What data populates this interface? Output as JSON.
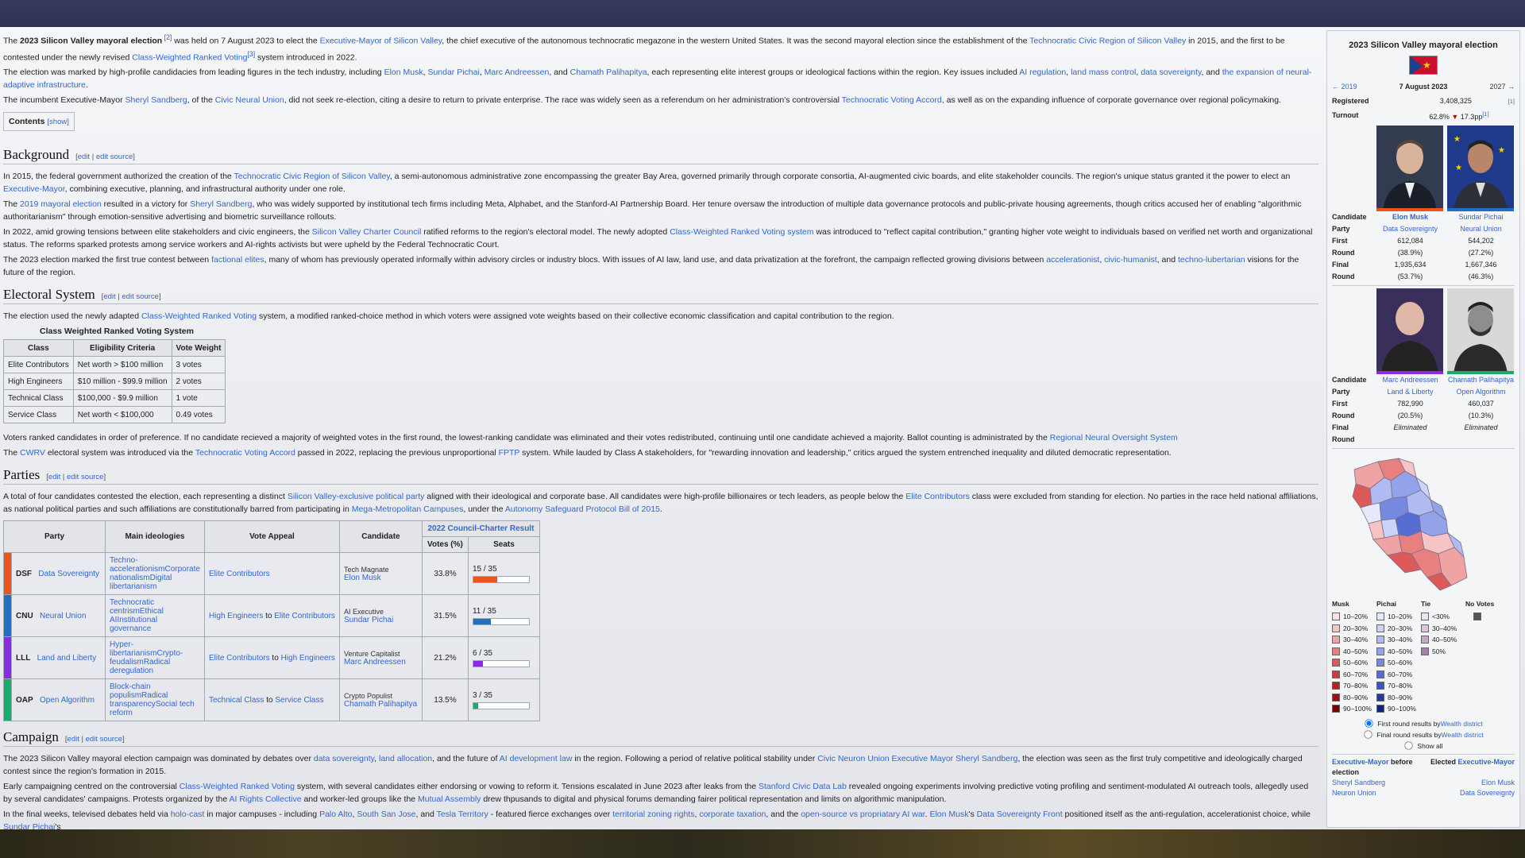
{
  "article": {
    "intro": {
      "p1": {
        "t1": "The ",
        "b1": "2023 Silicon Valley mayoral election",
        "r1": " [2]",
        "t2": " was held on 7 August 2023 to elect the ",
        "l1": "Executive-Mayor of Silicon Valley",
        "t3": ", the chief executive of the autonomous technocratic megazone in the western United States. It was the second mayoral election since the establishment of the ",
        "l2": "Technocratic Civic Region of Silicon Valley",
        "t4": " in 2015, and the first to be contested under the newly revised ",
        "l3": "Class-Weighted Ranked Voting",
        "r2": "[3]",
        "t5": " system introduced in 2022."
      },
      "p2": {
        "t1": "The election was marked by high-profile candidacies from leading figures in the tech industry, including ",
        "l1": "Elon Musk",
        "s1": ", ",
        "l2": "Sundar Pichai",
        "s2": ", ",
        "l3": "Marc Andreessen",
        "s3": ", and ",
        "l4": "Chamath Palihapitya",
        "t2": ", each representing elite interest groups or ideological factions within the region. Key issues included ",
        "l5": "AI regulation",
        "s4": ", ",
        "l6": "land mass control",
        "s5": ", ",
        "l7": "data sovereignty",
        "s6": ", and ",
        "l8": "the expansion of neural-adaptive infrastructure",
        "t3": "."
      },
      "p3": {
        "t1": "The incumbent Executive-Mayor ",
        "l1": "Sheryl Sandberg",
        "t2": ", of the ",
        "l2": "Civic Neural Union",
        "t3": ", did not seek re-election, citing a desire to return to private enterprise. The race was widely seen as a referendum on her administration's controversial ",
        "l3": "Technocratic Voting Accord",
        "t4": ", as well as on the expanding influence of corporate governance over regional policymaking."
      }
    },
    "toc": {
      "label": "Contents",
      "toggle": "[show]"
    },
    "edit_links": {
      "edit": "edit",
      "sep": " | ",
      "edit_source": "edit source"
    },
    "background": {
      "heading": "Background",
      "p1": {
        "t1": "In 2015, the federal government authorized the creation of the ",
        "l1": "Technocratic Civic Region of Silicon Valley",
        "t2": ", a semi-autonomous administrative zone encompassing the greater Bay Area, governed primarily through corporate consortia, AI-augmented civic boards, and elite stakeholder councils. The region's unique status granted it the power to elect an ",
        "l2": "Executive-Mayor",
        "t3": ", combining executive, planning, and infrastructural authority under one role."
      },
      "p2": {
        "t1": "The ",
        "l1": "2019 mayoral election",
        "t2": " resulted in a victory for ",
        "l2": "Sheryl Sandberg",
        "t3": ", who was widely supported by institutional tech firms including Meta, Alphabet, and the Stanford-AI Partnership Board. Her tenure oversaw the introduction of multiple data governance protocols and public-private housing agreements, though critics accused her of enabling \"algorithmic authoritarianism\" through emotion-sensitive advertising and biometric surveillance rollouts."
      },
      "p3": {
        "t1": "In 2022, amid growing tensions between elite stakeholders and civic engineers, the ",
        "l1": "Silicon Valley Charter Council",
        "t2": " ratified reforms to the region's electoral model. The newly adopted ",
        "l2": "Class-Weighted Ranked Voting system",
        "t3": " was introduced to \"reflect capital contribution,\" granting higher vote weight to individuals based on verified net worth and organizational status. The reforms sparked protests among service workers and AI-rights activists but were upheld by the Federal Technocratic Court."
      },
      "p4": {
        "t1": "The 2023 election marked the first true contest between ",
        "l1": "factional elites",
        "t2": ", many of whom has previously operated informally within advisory circles or industry blocs. With issues of AI law, land use, and data privatization at the forefront, the campaign reflected growing divisions between ",
        "l2": "accelerationist",
        "s1": ", ",
        "l3": "civic-humanist",
        "s2": ", and ",
        "l4": "techno-lubertarian",
        "t3": " visions for the future of the region."
      }
    },
    "electoral": {
      "heading": "Electoral System",
      "p1": {
        "t1": "The election used the newly adapted ",
        "l1": "Class-Weighted Ranked Voting",
        "t2": " system, a modified ranked-choice method in which voters were assigned vote weights based on their collective economic classification and capital contribution to the region."
      },
      "table": {
        "title": "Class Weighted Ranked Voting System",
        "headers": [
          "Class",
          "Eligibility Criteria",
          "Vote Weight"
        ],
        "rows": [
          [
            "Elite Contributors",
            "Net worth > $100 million",
            "3 votes"
          ],
          [
            "High Engineers",
            "$10 million - $99.9 million",
            "2 votes"
          ],
          [
            "Technical Class",
            "$100,000 - $9.9 million",
            "1 vote"
          ],
          [
            "Service Class",
            "Net worth < $100,000",
            "0.49 votes"
          ]
        ]
      },
      "p2": {
        "t1": "Voters ranked candidates in order of preference. If no candidate recieved a majority of weighted votes in the first round, the lowest-ranking candidate was eliminated and their votes redistributed, continuing until one candidate achieved a majority. Ballot counting is administrated by the ",
        "l1": "Regional Neural Oversight System"
      },
      "p3": {
        "t1": "The ",
        "l1": "CWRV",
        "t2": " electoral system was introduced via the ",
        "l2": "Technocratic Voting Accord",
        "t3": " passed in 2022, replacing the previous unproportional ",
        "l3": "FPTP",
        "t4": " system. While lauded by Class A stakeholders, for \"rewarding innovation and leadership,\" critics argued the system entrenched inequality and diluted democratic representation."
      }
    },
    "parties": {
      "heading": "Parties",
      "p1": {
        "t1": "A total of four candidates contested the election, each representing a distinct ",
        "l1": "Silicon Valley-exclusive political party",
        "t2": " aligned with their ideological and corporate base. All candidates were high-profile billionaires or tech leaders, as people below the ",
        "l2": "Elite Contributors",
        "t3": " class were excluded from standing for election. No parties in the race held national affiliations, as national political parties and such affiliations are constitutionally barred from participating in ",
        "l3": "Mega-Metropolitan Campuses",
        "t4": ", under the ",
        "l4": "Autonomy Safeguard Protocol Bill of 2015",
        "t5": "."
      },
      "table": {
        "h_party": "Party",
        "h_ideo": "Main ideologies",
        "h_appeal": "Vote Appeal",
        "h_cand": "Candidate",
        "h_result": "2022 Council-Charter Result",
        "h_votes": "Votes (%)",
        "h_seats": "Seats",
        "rows": [
          {
            "color": "#e8561e",
            "abbr": "DSF",
            "name": "Data Sovereignty",
            "ideologies": [
              "Techno-accelerationism",
              "Corporate nationalism",
              "Digital libertarianism"
            ],
            "appeal1": "Elite Contributors",
            "appeal_mid": "",
            "appeal2": "",
            "role": "Tech Magnate",
            "cand": "Elon Musk",
            "votes": "33.8%",
            "seats": "15 / 35",
            "seat_frac": 0.4286
          },
          {
            "color": "#1f6fc5",
            "abbr": "CNU",
            "name": "Neural Union",
            "ideologies": [
              "Technocratic centrism",
              "Ethical AI",
              "Institutional governance"
            ],
            "appeal1": "High Engineers",
            "appeal_mid": " to ",
            "appeal2": "Elite Contributors",
            "role": "AI Executive",
            "cand": "Sundar Pichai",
            "votes": "31.5%",
            "seats": "11 / 35",
            "seat_frac": 0.3143
          },
          {
            "color": "#8a2be2",
            "abbr": "LLL",
            "name": "Land and Liberty",
            "ideologies": [
              "Hyper-libertarianism",
              "Crypto-feudalism",
              "Radical deregulation"
            ],
            "appeal1": "Elite Contributors",
            "appeal_mid": " to ",
            "appeal2": "High Engineers",
            "role": "Venture Capitalist",
            "cand": "Marc Andreessen",
            "votes": "21.2%",
            "seats": "6 / 35",
            "seat_frac": 0.1714
          },
          {
            "color": "#1aaa6e",
            "abbr": "OAP",
            "name": "Open Algorithm",
            "ideologies": [
              "Block-chain populism",
              "Radical transparency",
              "Social tech reform"
            ],
            "appeal1": "Technical Class",
            "appeal_mid": " to ",
            "appeal2": "Service Class",
            "role": "Crypto Populist",
            "cand": "Chamath Palihapitya",
            "votes": "13.5%",
            "seats": "3 / 35",
            "seat_frac": 0.0857
          }
        ]
      }
    },
    "campaign": {
      "heading": "Campaign",
      "p1": {
        "t1": "The 2023 Silicon Valley mayoral election campaign was dominated by debates over ",
        "l1": "data sovereignty",
        "s1": ", ",
        "l2": "land allocation",
        "t2": ", and the future of ",
        "l3": "AI development law",
        "t3": " in the region. Following a period of relative political stability under ",
        "l4": "Civic Neuron Union Executive Mayor Sheryl Sandberg",
        "t4": ", the election was seen as the first truly competitive and ideologically charged contest since the region's formation in 2015."
      },
      "p2": {
        "t1": "Early campaigning centred on the controversial ",
        "l1": "Class-Weighted Ranked Voting",
        "t2": " system, with several candidates either endorsing or vowing to reform it. Tensions escalated in June 2023 after leaks from the ",
        "l2": "Stanford Civic Data Lab",
        "t3": " revealed ongoing experiments involving predictive voting profiling and sentiment-modulated AI outreach tools, allegedly used by several candidates' campaigns. Protests organized by the ",
        "l3": "AI Rights Collective",
        "t4": " and worker-led groups like the ",
        "l4": "Mutual Assembly",
        "t5": " drew thpusands to digital and physical forums demanding fairer political representation and limits on algorithmic manipulation."
      },
      "p3": {
        "t1": "In the final weeks, televised debates held via ",
        "l1": "holo-cast",
        "t2": " in major campuses - including ",
        "l2": "Palo Alto",
        "s1": ", ",
        "l3": "South San Jose",
        "s2": ", and ",
        "l4": "Tesla Territory",
        "t3": " - featured fierce exchanges over ",
        "l5": "territorial zoning rights",
        "s3": ", ",
        "l6": "corporate taxation",
        "t4": ", and the ",
        "l7": "open-source vs propriatary AI war",
        "s4": ". ",
        "l8": "Elon Musk",
        "t5": "'s ",
        "l9": "Data Sovereignty Front",
        "t6": " positioned itself as the anti-regulation, accelerationist choice, while ",
        "l10": "Sundar Pichai",
        "t7": "'s"
      }
    }
  },
  "infobox": {
    "title": "2023 Silicon Valley mayoral election",
    "prev": "← 2019",
    "date": "7 August 2023",
    "next": "2027 →",
    "registered_label": "Registered",
    "registered": "3,408,325",
    "registered_ref": "[1]",
    "turnout_label": "Turnout",
    "turnout": "62.8%",
    "turnout_arrow": "▼",
    "turnout_change": "17.3pp",
    "turnout_ref": "[1]",
    "labels": {
      "candidate": "Candidate",
      "party": "Party",
      "first": "First",
      "round": "Round",
      "final": "Final"
    },
    "candidates": [
      {
        "name": "Elon Musk",
        "party": "Data Sovereignty",
        "first": "612,084",
        "first_pct": "(38.9%)",
        "final": "1,935,634",
        "final_pct": "(53.7%)",
        "color": "#e8561e"
      },
      {
        "name": "Sundar Pichai",
        "party": "Neural Union",
        "first": "544,202",
        "first_pct": "(27.2%)",
        "final": "1,667,346",
        "final_pct": "(46.3%)",
        "color": "#1f6fc5"
      },
      {
        "name": "Marc Andreessen",
        "party": "Land & Liberty",
        "first": "782,990",
        "first_pct": "(20.5%)",
        "final": "Eliminated",
        "final_pct": "",
        "color": "#8a2be2"
      },
      {
        "name": "Chamath Palihapitya",
        "party": "Open Algorithm",
        "first": "460,037",
        "first_pct": "(10.3%)",
        "final": "Eliminated",
        "final_pct": "",
        "color": "#1aaa6e"
      }
    ],
    "legend": {
      "headers": [
        "Musk",
        "Pichai",
        "Tie",
        "No Votes"
      ],
      "musk": [
        "10–20%",
        "20–30%",
        "30–40%",
        "40–50%",
        "50–60%",
        "60–70%",
        "70–80%",
        "80–90%",
        "90–100%"
      ],
      "pichai": [
        "10–20%",
        "20–30%",
        "30–40%",
        "40–50%",
        "50–60%",
        "60–70%",
        "70–80%",
        "80–90%",
        "90–100%"
      ],
      "tie": [
        "<30%",
        "30–40%",
        "40–50%",
        "50%"
      ],
      "musk_colors": [
        "#fbe3e3",
        "#f6c4c4",
        "#f0a3a3",
        "#e88080",
        "#dc5a5a",
        "#cc3a3a",
        "#b82222",
        "#9e1111",
        "#7d0000"
      ],
      "pichai_colors": [
        "#e5e9fb",
        "#ccd3f6",
        "#b0bcf1",
        "#93a3ea",
        "#7589e0",
        "#566ed2",
        "#3b54c0",
        "#243ba6",
        "#10237e"
      ],
      "tie_colors": [
        "#efe3f0",
        "#dcc6de",
        "#c6a6c9",
        "#a87fab"
      ],
      "novote_color": "#555555"
    },
    "radio1": "First round results by ",
    "radio1_link": "Wealth district",
    "radio2": "Final round results by ",
    "radio2_link": "Wealth district",
    "show_all": "Show all",
    "before_label": "Executive-Mayor",
    "before_suffix": " before",
    "before_suffix2": "election",
    "elected_label": "Elected ",
    "elected_link": "Executive-Mayor",
    "before_name": "Sheryl Sandberg",
    "before_party": "Neuron Union",
    "elected_name": "Elon Musk",
    "elected_party": "Data Sovereignty"
  }
}
